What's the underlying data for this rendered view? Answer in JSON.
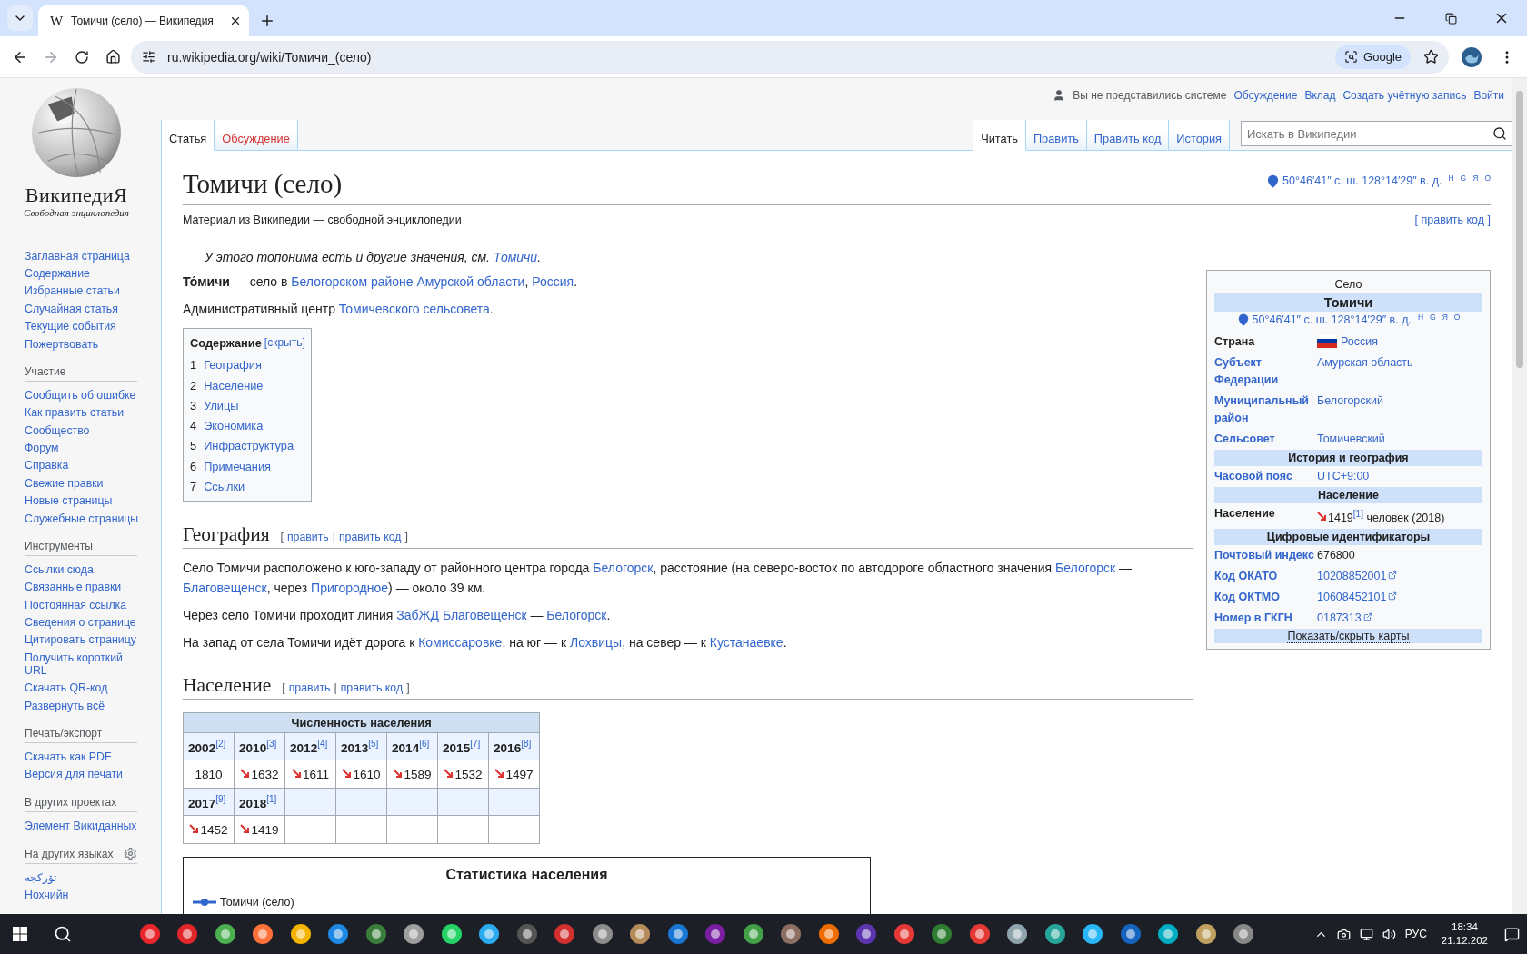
{
  "browser": {
    "tabs": [
      {
        "favicon": "W",
        "title": "Томичи (село) — Википедия",
        "selected": true
      }
    ],
    "url": "ru.wikipedia.org/wiki/Томичи_(село)",
    "lens_chip": "Google",
    "forward_enabled": false
  },
  "wiki": {
    "logo": {
      "wordmark": "ВикипедиЯ",
      "tagline": "Свободная энциклопедия"
    },
    "sidebar": [
      {
        "settings": false,
        "items": [
          "Заглавная страница",
          "Содержание",
          "Избранные статьи",
          "Случайная статья",
          "Текущие события",
          "Пожертвовать"
        ]
      },
      {
        "heading": "Участие",
        "settings": false,
        "items": [
          "Сообщить об ошибке",
          "Как править статьи",
          "Сообщество",
          "Форум",
          "Справка",
          "Свежие правки",
          "Новые страницы",
          "Служебные страницы"
        ]
      },
      {
        "heading": "Инструменты",
        "settings": false,
        "items": [
          "Ссылки сюда",
          "Связанные правки",
          "Постоянная ссылка",
          "Сведения о странице",
          "Цитировать страницу",
          "Получить короткий URL",
          "Скачать QR-код",
          "Развернуть всё"
        ]
      },
      {
        "heading": "Печать/экспорт",
        "settings": false,
        "items": [
          "Скачать как PDF",
          "Версия для печати"
        ]
      },
      {
        "heading": "В других проектах",
        "settings": false,
        "items": [
          "Элемент Викиданных"
        ]
      },
      {
        "heading": "На других языках",
        "settings": true,
        "items": [
          "تۆرکجه",
          "Нохчийн"
        ]
      }
    ],
    "personal": {
      "status": "Вы не представились системе",
      "links": [
        "Обсуждение",
        "Вклад",
        "Создать учётную запись",
        "Войти"
      ]
    },
    "namespace_tabs": [
      {
        "label": "Статья",
        "selected": true,
        "missing": false
      },
      {
        "label": "Обсуждение",
        "selected": false,
        "missing": true
      }
    ],
    "view_tabs": [
      {
        "label": "Читать",
        "selected": true
      },
      {
        "label": "Править",
        "selected": false
      },
      {
        "label": "Править код",
        "selected": false
      },
      {
        "label": "История",
        "selected": false
      }
    ],
    "search": {
      "placeholder": "Искать в Википедии"
    },
    "article": {
      "title": "Томичи (село)",
      "coords": "50°46′41″ с. ш. 128°14′29″ в. д.",
      "coord_links": [
        "H",
        "G",
        "Я",
        "O"
      ],
      "subtitle": "Материал из Википедии — свободной энциклопедии",
      "edit_link": "[ править код ]",
      "hatnote": [
        {
          "kind": "text",
          "t": "У этого топонима есть и другие значения, см. "
        },
        {
          "kind": "link",
          "t": "Томичи"
        },
        {
          "kind": "text",
          "t": "."
        }
      ],
      "intro": [
        [
          {
            "kind": "bold",
            "t": "То́мичи"
          },
          {
            "kind": "text",
            "t": " — село в "
          },
          {
            "kind": "link",
            "t": "Белогорском районе Амурской области"
          },
          {
            "kind": "text",
            "t": ", "
          },
          {
            "kind": "link",
            "t": "Россия"
          },
          {
            "kind": "text",
            "t": "."
          }
        ],
        [
          {
            "kind": "text",
            "t": "Административный центр "
          },
          {
            "kind": "link",
            "t": "Томичевского сельсовета"
          },
          {
            "kind": "text",
            "t": "."
          }
        ]
      ],
      "toc": {
        "title": "Содержание",
        "toggle": "[скрыть]",
        "items": [
          {
            "num": "1",
            "label": "География"
          },
          {
            "num": "2",
            "label": "Население"
          },
          {
            "num": "3",
            "label": "Улицы"
          },
          {
            "num": "4",
            "label": "Экономика"
          },
          {
            "num": "5",
            "label": "Инфраструктура"
          },
          {
            "num": "6",
            "label": "Примечания"
          },
          {
            "num": "7",
            "label": "Ссылки"
          }
        ]
      },
      "sections": [
        {
          "heading": "География",
          "edit": [
            {
              "kind": "text",
              "t": "["
            },
            {
              "kind": "link",
              "t": "править"
            },
            {
              "kind": "text",
              "t": "|"
            },
            {
              "kind": "link",
              "t": "править код"
            },
            {
              "kind": "text",
              "t": "]"
            }
          ],
          "paragraphs": [
            [
              {
                "kind": "text",
                "t": "Село Томичи расположено к юго-западу от районного центра города "
              },
              {
                "kind": "link",
                "t": "Белогорск"
              },
              {
                "kind": "text",
                "t": ", расстояние (на северо-восток по автодороге областного значения "
              },
              {
                "kind": "link",
                "t": "Белогорск"
              },
              {
                "kind": "text",
                "t": " — "
              },
              {
                "kind": "link",
                "t": "Благовещенск"
              },
              {
                "kind": "text",
                "t": ", через "
              },
              {
                "kind": "link",
                "t": "Пригородное"
              },
              {
                "kind": "text",
                "t": ") — около 39 км."
              }
            ],
            [
              {
                "kind": "text",
                "t": "Через село Томичи проходит линия "
              },
              {
                "kind": "link",
                "t": "ЗабЖД Благовещенск"
              },
              {
                "kind": "text",
                "t": " — "
              },
              {
                "kind": "link",
                "t": "Белогорск"
              },
              {
                "kind": "text",
                "t": "."
              }
            ],
            [
              {
                "kind": "text",
                "t": "На запад от села Томичи идёт дорога к "
              },
              {
                "kind": "link",
                "t": "Комиссаровке"
              },
              {
                "kind": "text",
                "t": ", на юг — к "
              },
              {
                "kind": "link",
                "t": "Лохвицы"
              },
              {
                "kind": "text",
                "t": ", на север — к "
              },
              {
                "kind": "link",
                "t": "Кустанаевке"
              },
              {
                "kind": "text",
                "t": "."
              }
            ]
          ]
        },
        {
          "heading": "Население",
          "edit": [
            {
              "kind": "text",
              "t": "["
            },
            {
              "kind": "link",
              "t": "править"
            },
            {
              "kind": "text",
              "t": "|"
            },
            {
              "kind": "link",
              "t": "править код"
            },
            {
              "kind": "text",
              "t": "]"
            }
          ]
        }
      ],
      "population_table": {
        "caption": "Численность населения",
        "entries": [
          {
            "year": "2002",
            "ref": "[2]",
            "value": "1810",
            "decrease": false
          },
          {
            "year": "2010",
            "ref": "[3]",
            "value": "1632",
            "decrease": true
          },
          {
            "year": "2012",
            "ref": "[4]",
            "value": "1611",
            "decrease": true
          },
          {
            "year": "2013",
            "ref": "[5]",
            "value": "1610",
            "decrease": true
          },
          {
            "year": "2014",
            "ref": "[6]",
            "value": "1589",
            "decrease": true
          },
          {
            "year": "2015",
            "ref": "[7]",
            "value": "1532",
            "decrease": true
          },
          {
            "year": "2016",
            "ref": "[8]",
            "value": "1497",
            "decrease": true
          },
          {
            "year": "2017",
            "ref": "[9]",
            "value": "1452",
            "decrease": true
          },
          {
            "year": "2018",
            "ref": "[1]",
            "value": "1419",
            "decrease": true
          }
        ]
      },
      "population_chart": {
        "title": "Статистика населения",
        "legend": [
          "Томичи (село)"
        ]
      },
      "infobox": {
        "caption": "Село",
        "name": "Томичи",
        "coords": "50°46′41″ с. ш. 128°14′29″ в. д.",
        "coord_links": [
          "H",
          "G",
          "Я",
          "O"
        ],
        "rows": [
          {
            "kind": "row",
            "label": "Страна",
            "label_link": false,
            "value": "Россия",
            "value_link": true,
            "flag": true,
            "external": false
          },
          {
            "kind": "row",
            "label": "Субъект Федерации",
            "label_link": true,
            "value": "Амурская область",
            "value_link": true,
            "flag": false,
            "external": false
          },
          {
            "kind": "row",
            "label": "Муниципальный район",
            "label_link": true,
            "value": "Белогорский",
            "value_link": true,
            "flag": false,
            "external": false
          },
          {
            "kind": "row",
            "label": "Сельсовет",
            "label_link": true,
            "value": "Томичевский",
            "value_link": true,
            "flag": false,
            "external": false
          },
          {
            "kind": "header",
            "text": "История и география"
          },
          {
            "kind": "row",
            "label": "Часовой пояс",
            "label_link": true,
            "value": "UTC+9:00",
            "value_link": true,
            "flag": false,
            "external": false
          },
          {
            "kind": "header",
            "text": "Население"
          },
          {
            "kind": "population",
            "label": "Население",
            "decrease": true,
            "value": "1419",
            "ref": "[1]",
            "suffix": " человек (2018)"
          },
          {
            "kind": "header",
            "text": "Цифровые идентификаторы"
          },
          {
            "kind": "row",
            "label": "Почтовый индекс",
            "label_link": true,
            "value": "676800",
            "value_link": false,
            "flag": false,
            "external": false
          },
          {
            "kind": "row",
            "label": "Код ОКАТО",
            "label_link": true,
            "value": "10208852001",
            "value_link": true,
            "flag": false,
            "external": true
          },
          {
            "kind": "row",
            "label": "Код ОКТМО",
            "label_link": true,
            "value": "10608452101",
            "value_link": true,
            "flag": false,
            "external": true
          },
          {
            "kind": "row",
            "label": "Номер в ГКГН",
            "label_link": true,
            "value": "0187313",
            "value_link": true,
            "flag": false,
            "external": true
          },
          {
            "kind": "footer",
            "text": "Показать/скрыть карты"
          }
        ]
      }
    }
  },
  "taskbar": {
    "language": "РУС",
    "time": "18:34",
    "date": "21.12.202"
  }
}
